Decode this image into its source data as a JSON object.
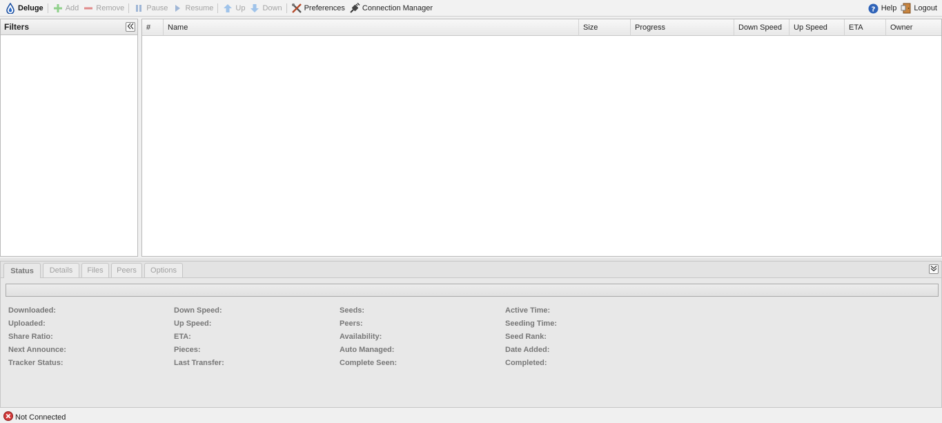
{
  "toolbar": {
    "brand": "Deluge",
    "add": "Add",
    "remove": "Remove",
    "pause": "Pause",
    "resume": "Resume",
    "up": "Up",
    "down": "Down",
    "preferences": "Preferences",
    "connection_manager": "Connection Manager",
    "help": "Help",
    "logout": "Logout"
  },
  "filters": {
    "title": "Filters"
  },
  "grid": {
    "columns": [
      "#",
      "Name",
      "Size",
      "Progress",
      "Down Speed",
      "Up Speed",
      "ETA",
      "Owner"
    ]
  },
  "tabs": [
    "Status",
    "Details",
    "Files",
    "Peers",
    "Options"
  ],
  "status": {
    "progress": 0,
    "columns": [
      [
        "Downloaded:",
        "Uploaded:",
        "Share Ratio:",
        "Next Announce:",
        "Tracker Status:"
      ],
      [
        "Down Speed:",
        "Up Speed:",
        "ETA:",
        "Pieces:",
        "Last Transfer:"
      ],
      [
        "Seeds:",
        "Peers:",
        "Availability:",
        "Auto Managed:",
        "Complete Seen:"
      ],
      [
        "Active Time:",
        "Seeding Time:",
        "Seed Rank:",
        "Date Added:",
        "Completed:"
      ]
    ]
  },
  "statusbar": {
    "text": "Not Connected"
  },
  "colors": {
    "accent": "#2a6bc9",
    "error": "#d33b3b"
  }
}
